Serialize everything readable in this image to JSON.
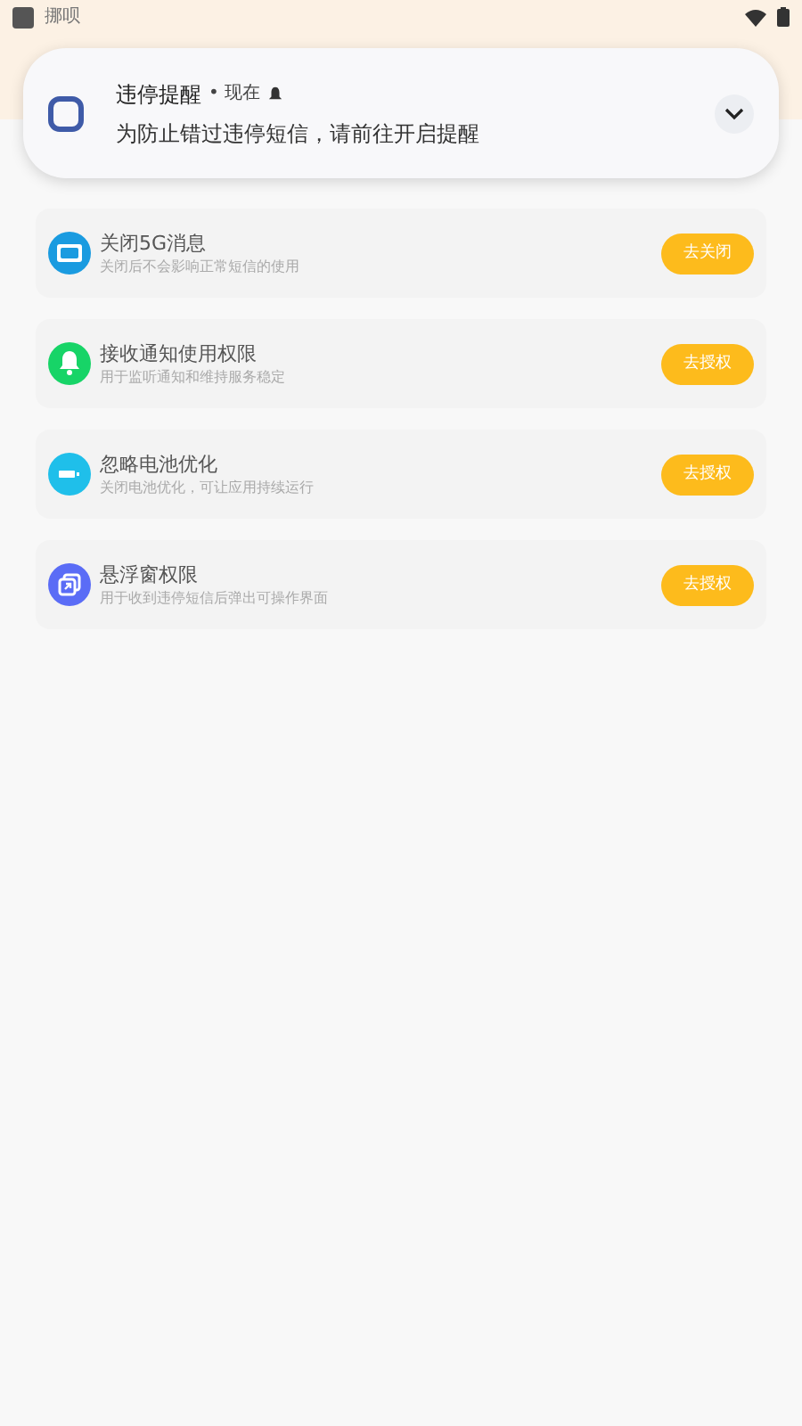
{
  "status_bar": {
    "app_name": "挪呗"
  },
  "notification": {
    "title": "违停提醒",
    "time": "• 现在",
    "message": "为防止错过违停短信，请前往开启提醒"
  },
  "permissions": [
    {
      "kind": "message",
      "title": "关闭5G消息",
      "subtitle": "关闭后不会影响正常短信的使用",
      "button": "去关闭"
    },
    {
      "kind": "bell",
      "title": "接收通知使用权限",
      "subtitle": "用于监听通知和维持服务稳定",
      "button": "去授权"
    },
    {
      "kind": "battery",
      "title": "忽略电池优化",
      "subtitle": "关闭电池优化，可让应用持续运行",
      "button": "去授权"
    },
    {
      "kind": "window",
      "title": "悬浮窗权限",
      "subtitle": "用于收到违停短信后弹出可操作界面",
      "button": "去授权"
    }
  ]
}
